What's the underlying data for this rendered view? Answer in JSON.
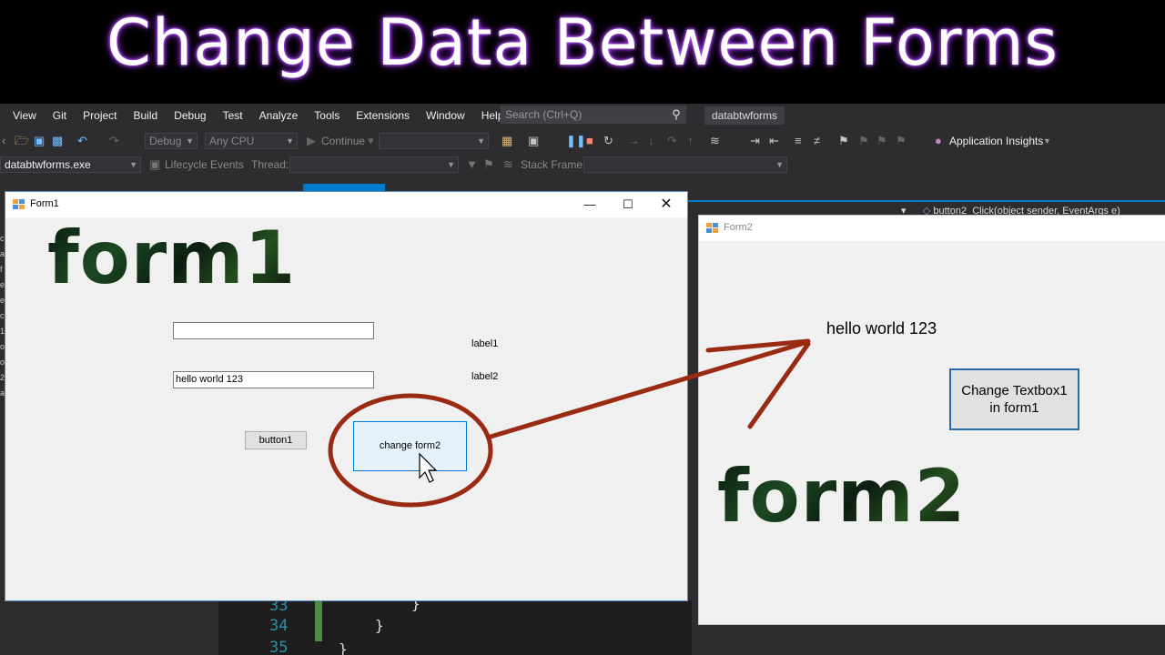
{
  "banner": {
    "title": "Change Data Between Forms"
  },
  "ide": {
    "menu": [
      "View",
      "Git",
      "Project",
      "Build",
      "Debug",
      "Test",
      "Analyze",
      "Tools",
      "Extensions",
      "Window",
      "Help"
    ],
    "search_placeholder": "Search (Ctrl+Q)",
    "solution_name": "databtwforms",
    "toolbar": {
      "config": "Debug",
      "platform": "Any CPU",
      "continue_label": "Continue",
      "app_insights": "Application Insights"
    },
    "toolbar2": {
      "process": "databtwforms.exe",
      "lifecycle": "Lifecycle Events",
      "thread_label": "Thread:",
      "stack_frame_label": "Stack Frame:"
    },
    "method_signature": "button2_Click(object sender, EventArgs e)",
    "code": {
      "line_numbers": [
        "33",
        "34",
        "35"
      ],
      "braces": [
        "}",
        "}",
        "}"
      ]
    }
  },
  "form1": {
    "title": "Form1",
    "big_word": "form1",
    "textbox1_value": "",
    "textbox2_value": "hello world 123",
    "label1": "label1",
    "label2": "label2",
    "button1": "button1",
    "button2": "change form2"
  },
  "form2": {
    "title": "Form2",
    "label": "hello world 123",
    "button_line1": "Change Textbox1",
    "button_line2": "in form1",
    "big_word": "form2"
  },
  "colors": {
    "annotation": "#9a2a12",
    "banner_glow": "#9a2cf0",
    "vs_accent": "#007acc"
  },
  "icons": [
    "search-icon",
    "minimize-icon",
    "maximize-icon",
    "close-icon",
    "app-icon",
    "mouse-cursor-icon",
    "pause-icon",
    "stop-icon",
    "restart-icon",
    "undo-icon",
    "save-icon",
    "open-folder-icon",
    "bookmark-icon",
    "lightbulb-icon",
    "filter-icon"
  ]
}
